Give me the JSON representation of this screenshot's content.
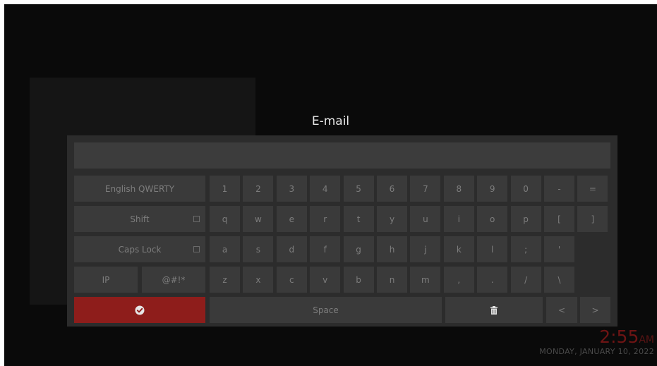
{
  "dialog": {
    "title": "E-mail",
    "input_value": ""
  },
  "keyboard": {
    "layout_label": "English QWERTY",
    "number_keys": [
      "1",
      "2",
      "3",
      "4",
      "5",
      "6",
      "7",
      "8",
      "9",
      "0",
      "-",
      "="
    ],
    "shift_label": "Shift",
    "row1_keys": [
      "q",
      "w",
      "e",
      "r",
      "t",
      "y",
      "u",
      "i",
      "o",
      "p",
      "[",
      "]"
    ],
    "capslock_label": "Caps Lock",
    "row2_keys": [
      "a",
      "s",
      "d",
      "f",
      "g",
      "h",
      "j",
      "k",
      "l",
      ";",
      "'"
    ],
    "ip_label": "IP",
    "symbols_label": "@#!*",
    "row3_keys": [
      "z",
      "x",
      "c",
      "v",
      "b",
      "n",
      "m",
      ",",
      ".",
      "/",
      "\\"
    ],
    "done_icon": "checkmark-circle-icon",
    "space_label": "Space",
    "delete_icon": "trash-icon",
    "left_label": "<",
    "right_label": ">"
  },
  "clock": {
    "time": "2:55",
    "ampm": "AM",
    "date": "MONDAY, JANUARY 10, 2022"
  },
  "colors": {
    "accent": "#8e1d1b",
    "key": "#3a3a3a",
    "panel": "#2c2c2c"
  }
}
